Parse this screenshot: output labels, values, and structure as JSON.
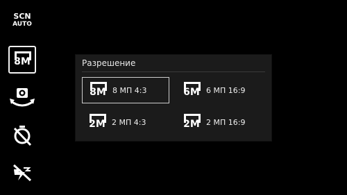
{
  "sidebar": {
    "scene": {
      "line1": "SCN",
      "line2": "AUTO"
    },
    "resolution_icon_text": "8M"
  },
  "dialog": {
    "title": "Разрешение",
    "options": [
      {
        "icon_text": "8M",
        "label": "8 МП 4:3",
        "selected": true
      },
      {
        "icon_text": "6M",
        "label": "6 МП 16:9",
        "selected": false
      },
      {
        "icon_text": "2M",
        "label": "2 МП 4:3",
        "selected": false
      },
      {
        "icon_text": "2M",
        "label": "2 МП 16:9",
        "selected": false
      }
    ]
  },
  "colors": {
    "background": "#000000",
    "dialog": "#1b1b1b",
    "text": "#ffffff"
  }
}
